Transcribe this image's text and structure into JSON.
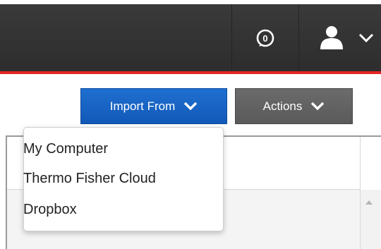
{
  "header": {
    "notification_count": "0",
    "icons": [
      "notification-badge-icon",
      "user-icon",
      "chevron-down-icon"
    ]
  },
  "toolbar": {
    "import_label": "Import From",
    "actions_label": "Actions"
  },
  "import_menu": {
    "items": [
      "My Computer",
      "Thermo Fisher Cloud",
      "Dropbox"
    ]
  },
  "colors": {
    "header_bg": "#333333",
    "accent_red": "#e32522",
    "import_button": "#1565c8",
    "actions_button": "#626262"
  }
}
